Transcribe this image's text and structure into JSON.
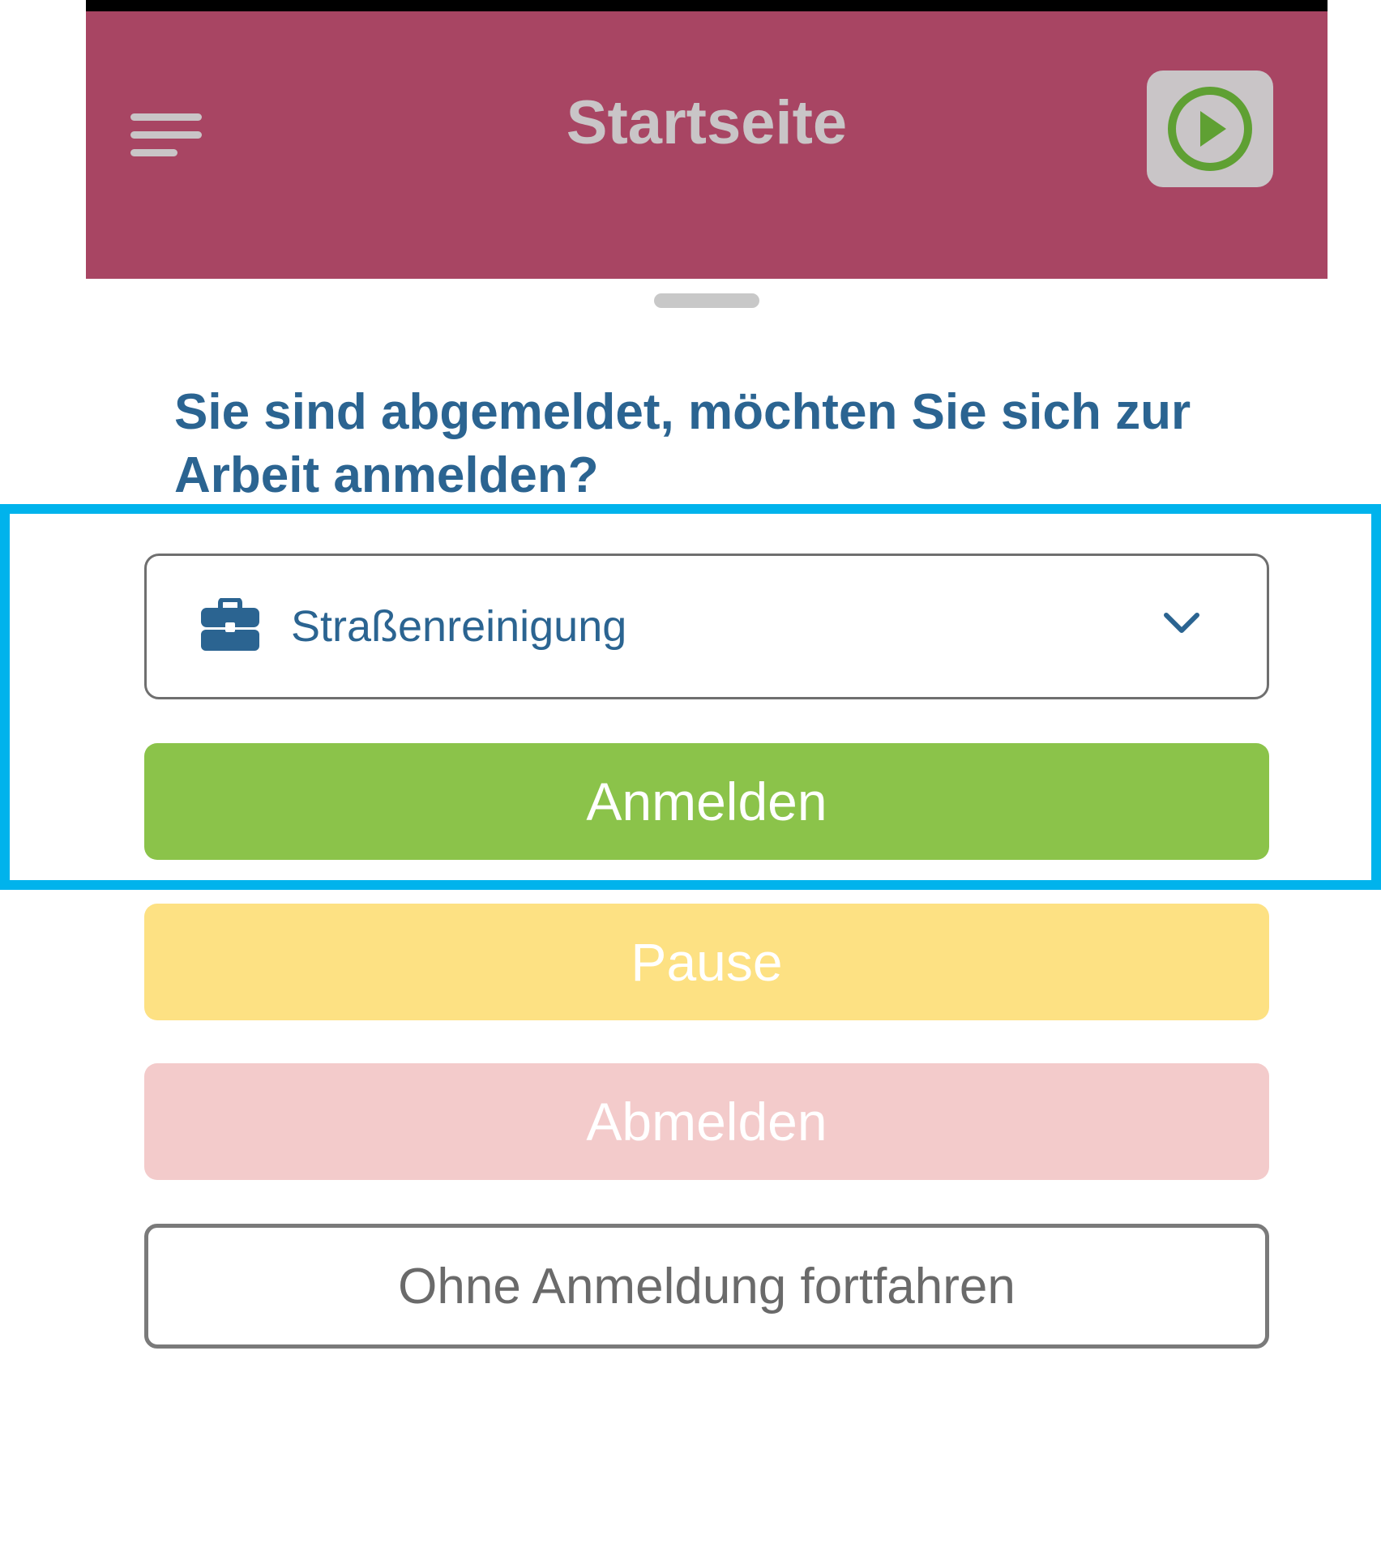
{
  "header": {
    "title": "Startseite",
    "background_color": "#a84563",
    "menu_icon": "menu-icon",
    "play_icon": "play-circle-icon"
  },
  "prompt": {
    "text": "Sie sind abgemeldet, möchten Sie sich zur Arbeit anmelden?"
  },
  "job_select": {
    "icon": "briefcase-icon",
    "selected_value": "Straßenreinigung",
    "dropdown_icon": "chevron-down-icon"
  },
  "buttons": {
    "login": {
      "label": "Anmelden",
      "color": "#8bc34a"
    },
    "pause": {
      "label": "Pause",
      "color": "#fde183"
    },
    "logout": {
      "label": "Abmelden",
      "color": "#f3cbcb"
    },
    "continue_without": {
      "label": "Ohne Anmeldung fortfahren"
    }
  },
  "highlight": {
    "color": "#00b3ec"
  }
}
